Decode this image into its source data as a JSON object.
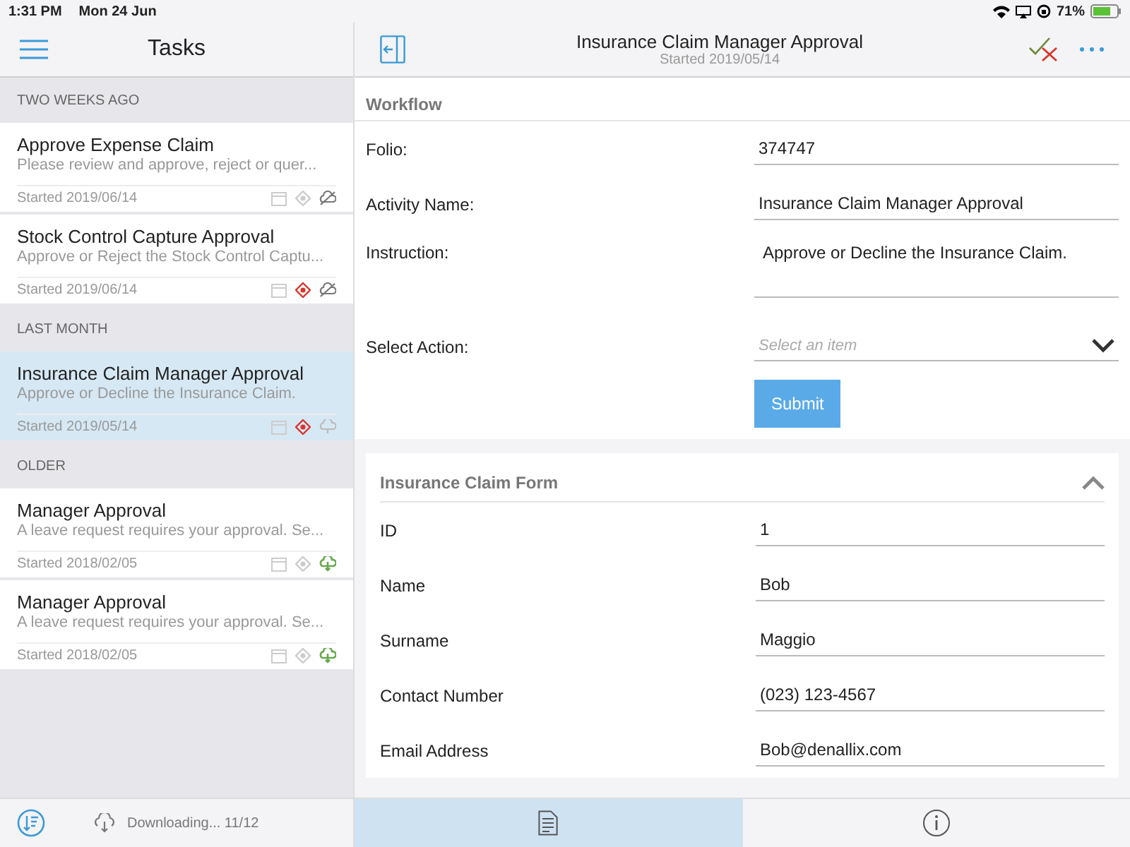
{
  "status_bar": {
    "time": "1:31 PM",
    "date": "Mon 24 Jun",
    "battery": "71%"
  },
  "sidebar": {
    "title": "Tasks",
    "groups": [
      {
        "heading": "TWO WEEKS AGO",
        "tasks": [
          {
            "title": "Approve Expense Claim",
            "description": "Please review and approve, reject or quer...",
            "started": "Started 2019/06/14",
            "selected": false,
            "high_priority": false,
            "kind": "offline"
          },
          {
            "title": "Stock Control Capture Approval",
            "description": "Approve or Reject the Stock Control Captu...",
            "started": "Started 2019/06/14",
            "selected": false,
            "high_priority": true,
            "kind": "offline"
          }
        ]
      },
      {
        "heading": "LAST MONTH",
        "tasks": [
          {
            "title": "Insurance Claim Manager Approval",
            "description": "Approve or Decline the Insurance Claim.",
            "started": "Started 2019/05/14",
            "selected": true,
            "high_priority": true,
            "kind": "cloud"
          }
        ]
      },
      {
        "heading": "OLDER",
        "tasks": [
          {
            "title": "Manager Approval",
            "description": "A leave request requires your approval. Se...",
            "started": "Started 2018/02/05",
            "selected": false,
            "high_priority": false,
            "kind": "downloaded"
          },
          {
            "title": "Manager Approval",
            "description": "A leave request requires your approval. Se...",
            "started": "Started 2018/02/05",
            "selected": false,
            "high_priority": false,
            "kind": "downloaded"
          }
        ]
      }
    ],
    "footer": {
      "status": "Downloading... 11/12"
    }
  },
  "detail": {
    "title": "Insurance Claim Manager Approval",
    "subtitle": "Started 2019/05/14",
    "workflow": {
      "heading": "Workflow",
      "fields": [
        {
          "label": "Folio:",
          "value": "374747",
          "kind": "text"
        },
        {
          "label": "Activity Name:",
          "value": "Insurance Claim Manager Approval",
          "kind": "text"
        },
        {
          "label": "Instruction:",
          "value": "Approve or Decline the Insurance Claim.",
          "kind": "multiline"
        },
        {
          "label": "Select Action:",
          "placeholder": "Select an item",
          "kind": "select"
        }
      ],
      "submit": "Submit"
    },
    "form": {
      "title": "Insurance Claim Form",
      "expanded": true,
      "fields": [
        {
          "label": "ID",
          "value": "1"
        },
        {
          "label": "Name",
          "value": "Bob"
        },
        {
          "label": "Surname",
          "value": "Maggio"
        },
        {
          "label": "Contact Number",
          "value": "(023) 123-4567"
        },
        {
          "label": "Email Address",
          "value": "Bob@denallix.com"
        }
      ]
    }
  },
  "tabs": [
    {
      "kind": "document",
      "selected": true
    },
    {
      "kind": "info",
      "selected": false
    }
  ]
}
